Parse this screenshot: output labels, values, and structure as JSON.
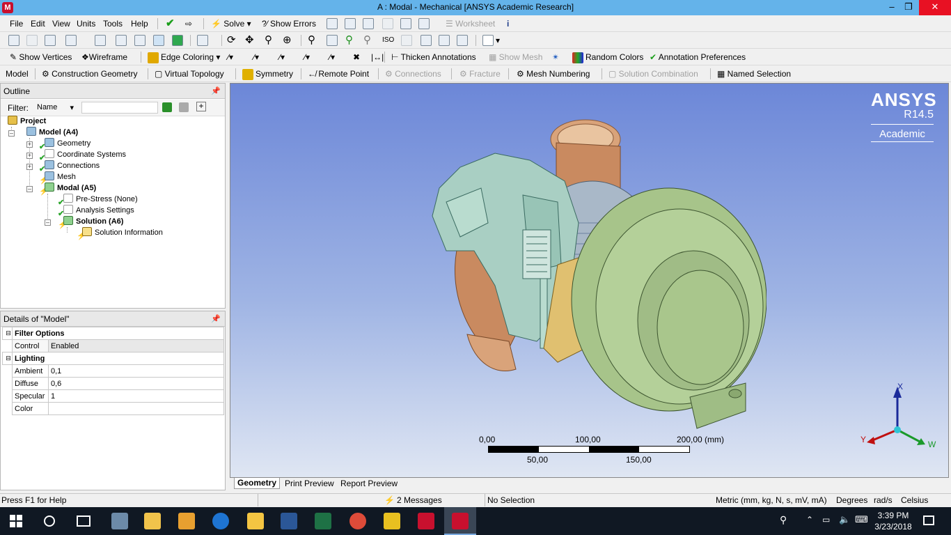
{
  "window": {
    "title": "A : Modal - Mechanical [ANSYS Academic Research]",
    "app_icon_letter": "M"
  },
  "menu": [
    "File",
    "Edit",
    "View",
    "Units",
    "Tools",
    "Help"
  ],
  "toolbar1": {
    "solve": "Solve",
    "show_errors": "?⁄ Show Errors",
    "worksheet": "Worksheet"
  },
  "toolbar3": {
    "show_vertices": "Show Vertices",
    "wireframe": "Wireframe",
    "edge_coloring": "Edge Coloring",
    "thicken": "Thicken Annotations",
    "show_mesh": "Show Mesh",
    "random_colors": "Random Colors",
    "annotation_prefs": "Annotation Preferences"
  },
  "toolbar4": {
    "model": "Model",
    "construction_geometry": "Construction Geometry",
    "virtual_topology": "Virtual Topology",
    "symmetry": "Symmetry",
    "remote_point": "Remote Point",
    "connections": "Connections",
    "fracture": "Fracture",
    "mesh_numbering": "Mesh Numbering",
    "solution_combination": "Solution Combination",
    "named_selection": "Named Selection"
  },
  "outline": {
    "title": "Outline",
    "filter_label": "Filter:",
    "filter_value": "Name",
    "tree": [
      {
        "label": "Project",
        "bold": true
      },
      {
        "label": "Model (A4)",
        "bold": true
      },
      {
        "label": "Geometry"
      },
      {
        "label": "Coordinate Systems"
      },
      {
        "label": "Connections"
      },
      {
        "label": "Mesh"
      },
      {
        "label": "Modal (A5)",
        "bold": true
      },
      {
        "label": "Pre-Stress (None)"
      },
      {
        "label": "Analysis Settings"
      },
      {
        "label": "Solution (A6)",
        "bold": true
      },
      {
        "label": "Solution Information"
      }
    ]
  },
  "details": {
    "title": "Details of \"Model\"",
    "groups": [
      {
        "name": "Filter Options",
        "rows": [
          {
            "k": "Control",
            "v": "Enabled"
          }
        ]
      },
      {
        "name": "Lighting",
        "rows": [
          {
            "k": "Ambient",
            "v": "0,1"
          },
          {
            "k": "Diffuse",
            "v": "0,6"
          },
          {
            "k": "Specular",
            "v": "1"
          },
          {
            "k": "Color",
            "v": ""
          }
        ]
      }
    ]
  },
  "viewport": {
    "brand": "ANSYS",
    "version": "R14.5",
    "edition": "Academic",
    "scale": {
      "t0": "0,00",
      "t100": "100,00",
      "t200": "200,00 (mm)",
      "t50": "50,00",
      "t150": "150,00"
    },
    "axes": {
      "x": "X",
      "y": "Y",
      "z": "W"
    }
  },
  "view_tabs": [
    "Geometry",
    "Print Preview",
    "Report Preview"
  ],
  "status": {
    "help": "Press F1 for Help",
    "messages": "2 Messages",
    "selection": "No Selection",
    "units": "Metric (mm, kg, N, s, mV, mA)",
    "angle": "Degrees",
    "rate": "rad/s",
    "temp": "Celsius"
  },
  "taskbar": {
    "time": "3:39 PM",
    "date": "3/23/2018"
  }
}
